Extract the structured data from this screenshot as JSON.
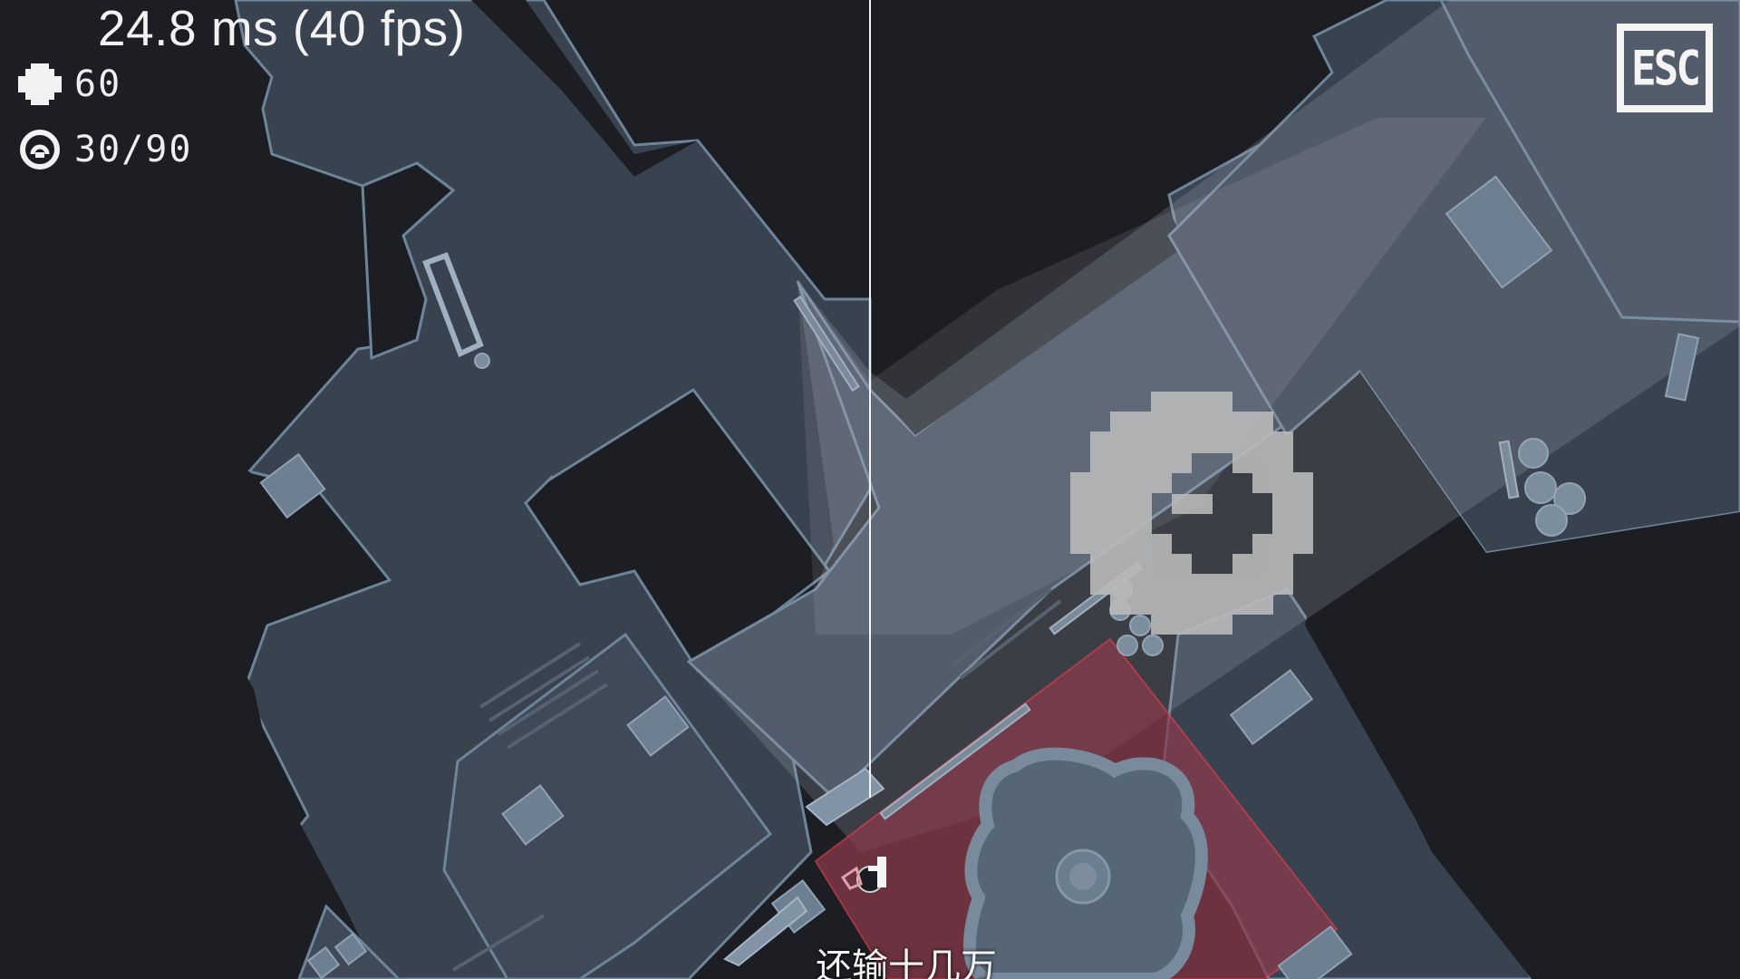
{
  "hud": {
    "frame_time": "24.8 ms (40 fps)",
    "health": "60",
    "ammo": "30/90",
    "esc_label": "ESC"
  },
  "subtitle": "还输十几万",
  "icons": {
    "health": "health-cross-icon",
    "ammo": "ammo-target-icon",
    "pause": "esc-pause-icon",
    "interact": "pixel-ring-interact-icon",
    "player": "player-character-icon"
  },
  "colors": {
    "background": "#1d1e23",
    "floor": "#3b4554",
    "floor_edge": "#6f879a",
    "light_cone": "#a7b2bd",
    "zone": "#8b3a4c",
    "zone_edge": "#d94050",
    "hud_text": "#f2f2f2"
  }
}
